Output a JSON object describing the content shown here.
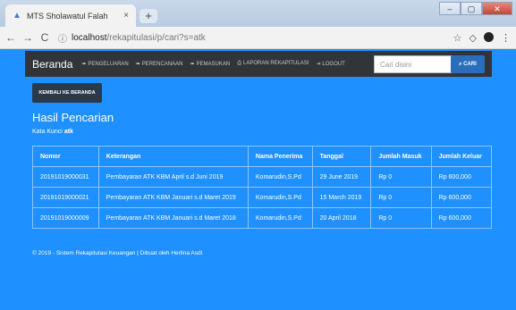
{
  "browser": {
    "tab_title": "MTS Sholawatul Falah",
    "tab_close": "×",
    "new_tab": "+",
    "url_host": "localhost",
    "url_path": "/rekapitulasi/p/cari?s=atk"
  },
  "navbar": {
    "brand": "Beranda",
    "links": [
      "PENGELUARAN",
      "PERENCANAAN",
      "PEMASUKAN",
      "LAPORAN REKAPITULASI",
      "LOGOUT"
    ],
    "search_placeholder": "Cari disini",
    "search_button": "CARI"
  },
  "back_button": "KEMBALI KE BERANDA",
  "heading": "Hasil Pencarian",
  "keyword_label": "Kata Kunci",
  "keyword_value": "atk",
  "table": {
    "headers": [
      "Nomor",
      "Keterangan",
      "Nama Penerima",
      "Tanggal",
      "Jumlah Masuk",
      "Jumlah Keluar"
    ],
    "rows": [
      [
        "20191019000031",
        "Pembayaran ATK KBM April s.d Juni 2019",
        "Komarudin,S.Pd",
        "29 June 2019",
        "Rp 0",
        "Rp 600,000"
      ],
      [
        "20191019000021",
        "Pembayaran ATK KBM Januari s.d Maret 2019",
        "Komarudin,S.Pd",
        "15 March 2019",
        "Rp 0",
        "Rp 600,000"
      ],
      [
        "20191019000009",
        "Pembayaran ATK KBM Januari s.d Maret 2018",
        "Komarudin,S.Pd",
        "20 April 2018",
        "Rp 0",
        "Rp 600,000"
      ]
    ]
  },
  "footer": "© 2019 - Sistem Rekapitulasi Keuangan | Dibuat oleh Herlina Asdi"
}
